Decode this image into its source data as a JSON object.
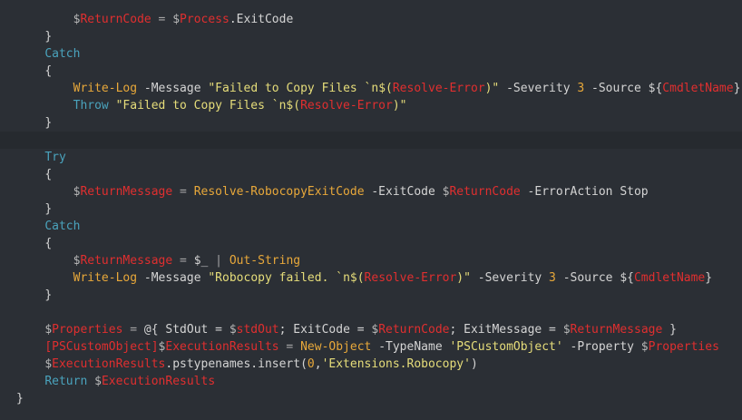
{
  "code_lines": [
    {
      "indent": "        ",
      "tokens": [
        {
          "t": "var",
          "v": "$ReturnCode"
        },
        {
          "t": "op",
          "v": " = "
        },
        {
          "t": "var",
          "v": "$Process"
        },
        {
          "t": "pl",
          "v": ".ExitCode"
        }
      ]
    },
    {
      "indent": "    ",
      "tokens": [
        {
          "t": "pl",
          "v": "}"
        }
      ]
    },
    {
      "indent": "    ",
      "tokens": [
        {
          "t": "kw",
          "v": "Catch"
        }
      ]
    },
    {
      "indent": "    ",
      "tokens": [
        {
          "t": "pl",
          "v": "{"
        }
      ]
    },
    {
      "indent": "        ",
      "tokens": [
        {
          "t": "cmd",
          "v": "Write-Log"
        },
        {
          "t": "param",
          "v": " -Message "
        },
        {
          "t": "str",
          "v": "\"Failed to Copy Files `n$("
        },
        {
          "t": "sub",
          "v": "Resolve-Error"
        },
        {
          "t": "str",
          "v": ")\""
        },
        {
          "t": "param",
          "v": " -Severity "
        },
        {
          "t": "num",
          "v": "3"
        },
        {
          "t": "param",
          "v": " -Source "
        },
        {
          "t": "pl",
          "v": "${"
        },
        {
          "t": "sub",
          "v": "CmdletName"
        },
        {
          "t": "pl",
          "v": "}"
        }
      ]
    },
    {
      "indent": "        ",
      "tokens": [
        {
          "t": "kw",
          "v": "Throw"
        },
        {
          "t": "pl",
          "v": " "
        },
        {
          "t": "str",
          "v": "\"Failed to Copy Files `n$("
        },
        {
          "t": "sub",
          "v": "Resolve-Error"
        },
        {
          "t": "str",
          "v": ")\""
        }
      ]
    },
    {
      "indent": "    ",
      "tokens": [
        {
          "t": "pl",
          "v": "}"
        }
      ]
    },
    {
      "indent": "",
      "tokens": [],
      "highlight": true
    },
    {
      "indent": "    ",
      "tokens": [
        {
          "t": "kw",
          "v": "Try"
        }
      ]
    },
    {
      "indent": "    ",
      "tokens": [
        {
          "t": "pl",
          "v": "{"
        }
      ]
    },
    {
      "indent": "        ",
      "tokens": [
        {
          "t": "var",
          "v": "$ReturnMessage"
        },
        {
          "t": "op",
          "v": " = "
        },
        {
          "t": "cmd",
          "v": "Resolve-RobocopyExitCode"
        },
        {
          "t": "param",
          "v": " -ExitCode "
        },
        {
          "t": "var",
          "v": "$ReturnCode"
        },
        {
          "t": "param",
          "v": " -ErrorAction "
        },
        {
          "t": "pl",
          "v": "Stop"
        }
      ]
    },
    {
      "indent": "    ",
      "tokens": [
        {
          "t": "pl",
          "v": "}"
        }
      ]
    },
    {
      "indent": "    ",
      "tokens": [
        {
          "t": "kw",
          "v": "Catch"
        }
      ]
    },
    {
      "indent": "    ",
      "tokens": [
        {
          "t": "pl",
          "v": "{"
        }
      ]
    },
    {
      "indent": "        ",
      "tokens": [
        {
          "t": "var",
          "v": "$ReturnMessage"
        },
        {
          "t": "op",
          "v": " = "
        },
        {
          "t": "pl",
          "v": "$_"
        },
        {
          "t": "op",
          "v": " | "
        },
        {
          "t": "cmd",
          "v": "Out-String"
        }
      ]
    },
    {
      "indent": "        ",
      "tokens": [
        {
          "t": "cmd",
          "v": "Write-Log"
        },
        {
          "t": "param",
          "v": " -Message "
        },
        {
          "t": "str",
          "v": "\"Robocopy failed. `n$("
        },
        {
          "t": "sub",
          "v": "Resolve-Error"
        },
        {
          "t": "str",
          "v": ")\""
        },
        {
          "t": "param",
          "v": " -Severity "
        },
        {
          "t": "num",
          "v": "3"
        },
        {
          "t": "param",
          "v": " -Source "
        },
        {
          "t": "pl",
          "v": "${"
        },
        {
          "t": "sub",
          "v": "CmdletName"
        },
        {
          "t": "pl",
          "v": "}"
        }
      ]
    },
    {
      "indent": "    ",
      "tokens": [
        {
          "t": "pl",
          "v": "}"
        }
      ]
    },
    {
      "indent": "",
      "tokens": []
    },
    {
      "indent": "    ",
      "tokens": [
        {
          "t": "var",
          "v": "$Properties"
        },
        {
          "t": "op",
          "v": " = "
        },
        {
          "t": "pl",
          "v": "@{ StdOut = "
        },
        {
          "t": "var",
          "v": "$stdOut"
        },
        {
          "t": "pl",
          "v": "; ExitCode = "
        },
        {
          "t": "var",
          "v": "$ReturnCode"
        },
        {
          "t": "pl",
          "v": "; ExitMessage = "
        },
        {
          "t": "var",
          "v": "$ReturnMessage"
        },
        {
          "t": "pl",
          "v": " }"
        }
      ]
    },
    {
      "indent": "    ",
      "tokens": [
        {
          "t": "type",
          "v": "[PSCustomObject]"
        },
        {
          "t": "var",
          "v": "$ExecutionResults"
        },
        {
          "t": "op",
          "v": " = "
        },
        {
          "t": "cmd",
          "v": "New-Object"
        },
        {
          "t": "param",
          "v": " -TypeName "
        },
        {
          "t": "str",
          "v": "'PSCustomObject'"
        },
        {
          "t": "param",
          "v": " -Property "
        },
        {
          "t": "var",
          "v": "$Properties"
        }
      ]
    },
    {
      "indent": "    ",
      "tokens": [
        {
          "t": "var",
          "v": "$ExecutionResults"
        },
        {
          "t": "pl",
          "v": ".pstypenames.insert("
        },
        {
          "t": "num",
          "v": "0"
        },
        {
          "t": "pl",
          "v": ","
        },
        {
          "t": "str",
          "v": "'Extensions.Robocopy'"
        },
        {
          "t": "pl",
          "v": ")"
        }
      ]
    },
    {
      "indent": "    ",
      "tokens": [
        {
          "t": "kw",
          "v": "Return"
        },
        {
          "t": "pl",
          "v": " "
        },
        {
          "t": "var",
          "v": "$ExecutionResults"
        }
      ]
    },
    {
      "indent": "",
      "tokens": [
        {
          "t": "pl",
          "v": "}"
        }
      ]
    }
  ]
}
